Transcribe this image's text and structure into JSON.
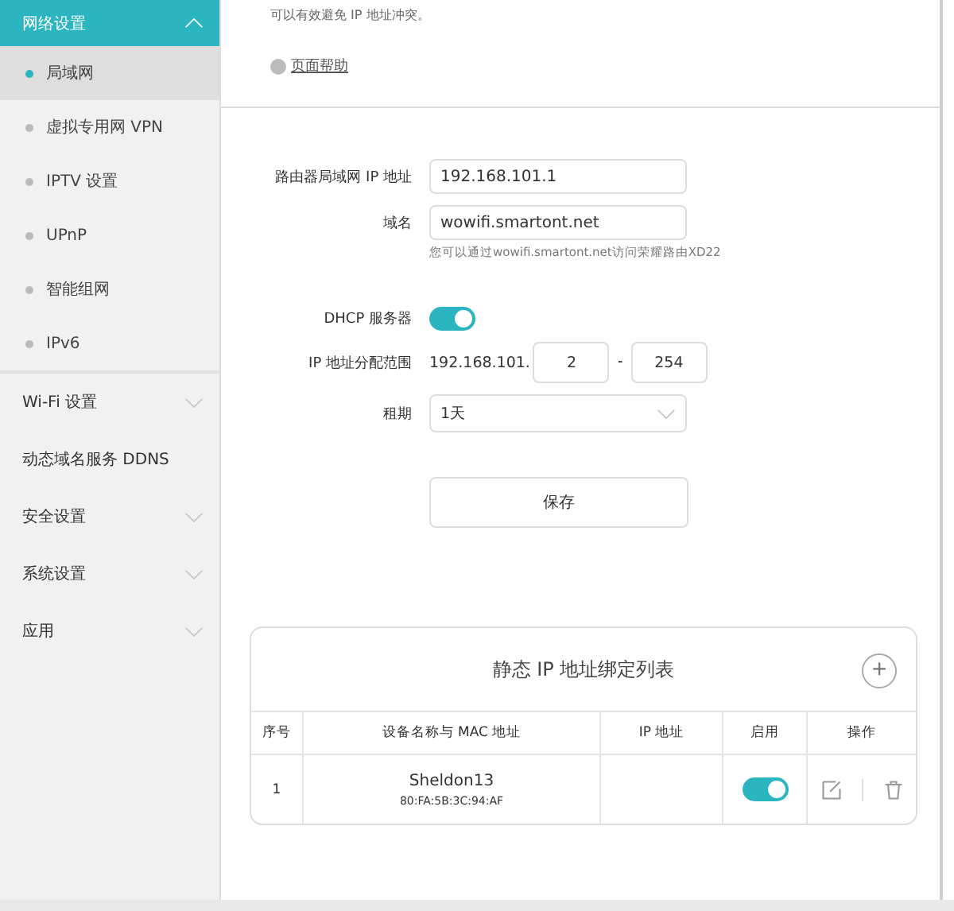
{
  "sidebar": {
    "items": [
      {
        "label": "网络设置",
        "expanded": true,
        "expandable": true,
        "children": [
          {
            "label": "局域网",
            "selected": true
          },
          {
            "label": "虚拟专用网 VPN",
            "selected": false
          },
          {
            "label": "IPTV 设置",
            "selected": false
          },
          {
            "label": "UPnP",
            "selected": false
          },
          {
            "label": "智能组网",
            "selected": false
          },
          {
            "label": "IPv6",
            "selected": false
          }
        ]
      },
      {
        "label": "Wi-Fi 设置",
        "expanded": false,
        "expandable": true
      },
      {
        "label": "动态域名服务 DDNS",
        "expanded": false,
        "expandable": false
      },
      {
        "label": "安全设置",
        "expanded": false,
        "expandable": true
      },
      {
        "label": "系统设置",
        "expanded": false,
        "expandable": true
      },
      {
        "label": "应用",
        "expanded": false,
        "expandable": true
      }
    ]
  },
  "intro": {
    "text": "可以有效避免 IP 地址冲突。",
    "help_link": "页面帮助"
  },
  "form": {
    "lan_ip": {
      "label": "路由器局域网 IP 地址",
      "value": "192.168.101.1"
    },
    "domain": {
      "label": "域名",
      "value": "wowifi.smartont.net",
      "hint": "您可以通过wowifi.smartont.net访问荣耀路由XD22"
    },
    "dhcp": {
      "label": "DHCP 服务器",
      "on": true
    },
    "range": {
      "label": "IP 地址分配范围",
      "prefix": "192.168.101.",
      "start": "2",
      "separator": "-",
      "end": "254"
    },
    "lease": {
      "label": "租期",
      "value": "1天"
    },
    "save_button": "保存"
  },
  "static_table": {
    "title": "静态 IP 地址绑定列表",
    "add_button": "+",
    "columns": [
      "序号",
      "设备名称与 MAC 地址",
      "IP 地址",
      "启用",
      "操作"
    ],
    "rows": [
      {
        "index": "1",
        "name": "Sheldon13",
        "mac": "80:FA:5B:3C:94:AF",
        "enabled": true
      }
    ]
  }
}
